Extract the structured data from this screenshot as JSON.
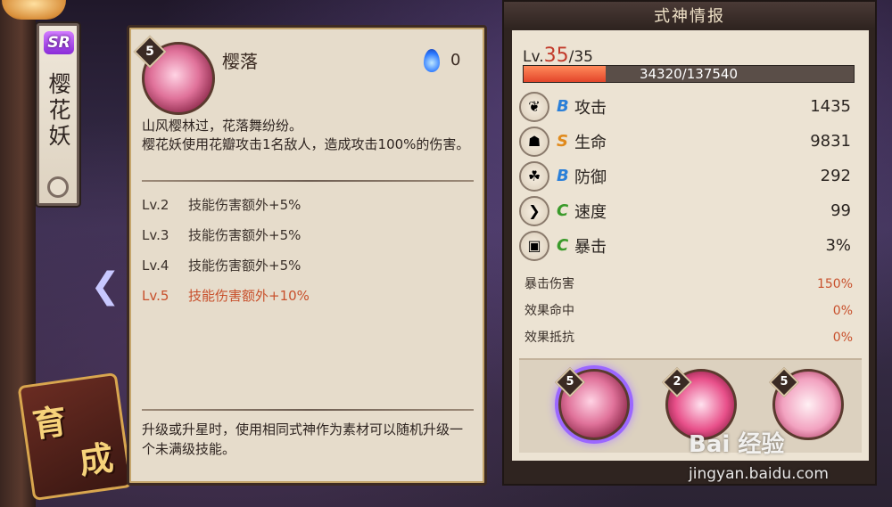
{
  "shikigami": {
    "rarity": "SR",
    "name": "樱花妖"
  },
  "side_badge": "育成",
  "skill": {
    "level": "5",
    "name": "樱落",
    "orb_cost": "0",
    "description_line1": "山风樱林过，花落舞纷纷。",
    "description_line2": "樱花妖使用花瓣攻击1名敌人，造成攻击100%的伤害。",
    "levels": [
      {
        "lv": "Lv.2",
        "effect": "技能伤害额外+5%"
      },
      {
        "lv": "Lv.3",
        "effect": "技能伤害额外+5%"
      },
      {
        "lv": "Lv.4",
        "effect": "技能伤害额外+5%"
      },
      {
        "lv": "Lv.5",
        "effect": "技能伤害额外+10%"
      }
    ],
    "upgrade_tip": "升级或升星时，使用相同式神作为素材可以随机升级一个未满级技能。"
  },
  "info": {
    "title": "式神情报",
    "level_prefix": "Lv.",
    "level_current": "35",
    "level_max": "/35",
    "xp_text": "34320/137540",
    "xp_fraction": 0.2495,
    "stats": [
      {
        "grade": "B",
        "name": "攻击",
        "value": "1435",
        "icon": "fan-icon"
      },
      {
        "grade": "S",
        "name": "生命",
        "value": "9831",
        "icon": "talisman-icon"
      },
      {
        "grade": "B",
        "name": "防御",
        "value": "292",
        "icon": "armor-icon"
      },
      {
        "grade": "C",
        "name": "速度",
        "value": "99",
        "icon": "boot-icon"
      },
      {
        "grade": "C",
        "name": "暴击",
        "value": "3%",
        "icon": "scroll-icon"
      }
    ],
    "substats": [
      {
        "name": "暴击伤害",
        "value": "150%"
      },
      {
        "name": "效果命中",
        "value": "0%"
      },
      {
        "name": "效果抵抗",
        "value": "0%"
      }
    ],
    "skill_slots": [
      {
        "level": "5"
      },
      {
        "level": "2"
      },
      {
        "level": "5"
      }
    ]
  },
  "watermark": {
    "brand": "Bai  经验",
    "url": "jingyan.baidu.com"
  },
  "colors": {
    "grade_B": "#2a7fd8",
    "grade_S": "#e08a1c",
    "grade_C": "#3a9a2a",
    "highlight": "#c8502c",
    "level_red": "#c23a2a"
  }
}
